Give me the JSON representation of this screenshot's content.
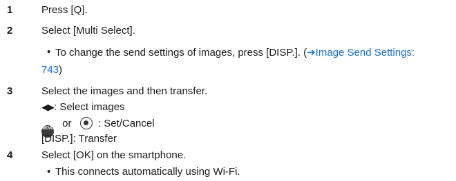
{
  "steps": [
    {
      "num": "1",
      "text": "Press [Q]."
    },
    {
      "num": "2",
      "text": "Select [Multi Select]."
    },
    {
      "num": "3",
      "text": "Select the images and then transfer."
    },
    {
      "num": "4",
      "text": "Select [OK] on the smartphone."
    }
  ],
  "step2_note": {
    "bullet": "•",
    "prefix": "To change the send settings of images, press [DISP.]. (",
    "arrow": "➔",
    "link_text": "Image Send Settings:",
    "link_page": "743",
    "suffix": ")"
  },
  "step3_items": {
    "arrows": "◀▶",
    "select_images": ": Select images",
    "menu_icon_label": "MENU/SET",
    "or_text": "or",
    "set_cancel": ": Set/Cancel",
    "disp_transfer": "[DISP.]: Transfer"
  },
  "step4_note": {
    "bullet": "•",
    "text": "This connects automatically using Wi-Fi."
  },
  "icons": {
    "menu": "menu-set-button-icon",
    "dial": "control-dial-press-icon",
    "arrows": "left-right-arrows-icon",
    "link_arrow": "reference-arrow-icon"
  },
  "colors": {
    "text": "#1a1a1a",
    "link": "#1a6fc9"
  }
}
